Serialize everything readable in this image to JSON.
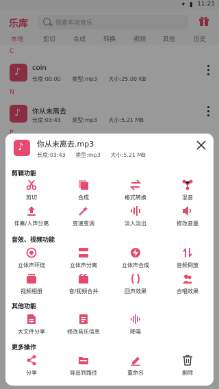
{
  "status": {
    "time": "11:21"
  },
  "app": {
    "title": "乐库",
    "search_placeholder": "搜索本地音乐"
  },
  "tabs": [
    "本地",
    "剪切",
    "合成",
    "转换",
    "视频",
    "其他",
    "历史"
  ],
  "songs": {
    "group_c": "C",
    "group_n": "N",
    "group_p": "P",
    "items": [
      {
        "name": "coin",
        "length": "长度:00:00",
        "type": "类型:mp3",
        "size": "大小:25.00 KB"
      },
      {
        "name": "你从未离去",
        "length": "长度:03:43",
        "type": "类型:mp3",
        "size": "大小:5.21 MB"
      }
    ]
  },
  "sheet": {
    "title": "你从未离去.mp3",
    "length": "长度:03:43",
    "type": "类型:mp3",
    "size": "大小:5.21 MB",
    "sections": [
      {
        "title": "剪辑功能",
        "items": [
          {
            "label": "剪切",
            "icon": "scissors-icon"
          },
          {
            "label": "合成",
            "icon": "stack-icon"
          },
          {
            "label": "格式转换",
            "icon": "swap-icon"
          },
          {
            "label": "混音",
            "icon": "mix-icon"
          },
          {
            "label": "伴奏/人声分离",
            "icon": "upload-icon"
          },
          {
            "label": "变速变调",
            "icon": "magic-wand-icon"
          },
          {
            "label": "淡入淡出",
            "icon": "fade-bars-icon"
          },
          {
            "label": "修改音量",
            "icon": "volume-icon"
          }
        ]
      },
      {
        "title": "音效、视频功能",
        "items": [
          {
            "label": "立体声环绕",
            "icon": "surround-icon"
          },
          {
            "label": "立体声分离",
            "icon": "split-icon"
          },
          {
            "label": "立体声合成",
            "icon": "bolt-icon"
          },
          {
            "label": "音频倒放",
            "icon": "reverse-icon"
          },
          {
            "label": "视频相册",
            "icon": "album-icon"
          },
          {
            "label": "音/视频合并",
            "icon": "video-merge-icon"
          },
          {
            "label": "回声效果",
            "icon": "echo-icon"
          },
          {
            "label": "合唱效果",
            "icon": "chorus-icon"
          }
        ]
      },
      {
        "title": "其他功能",
        "items": [
          {
            "label": "大文件分享",
            "icon": "file-share-icon"
          },
          {
            "label": "修改音乐信息",
            "icon": "doc-edit-icon"
          },
          {
            "label": "降噪",
            "icon": "waveform-icon"
          }
        ]
      },
      {
        "title": "更多操作",
        "items": [
          {
            "label": "分享",
            "icon": "share-icon"
          },
          {
            "label": "导出到路径",
            "icon": "export-folder-icon"
          },
          {
            "label": "重命名",
            "icon": "pencil-icon"
          },
          {
            "label": "删除",
            "icon": "trash-icon"
          }
        ]
      }
    ]
  },
  "colors": {
    "accent": "#e64a6e",
    "overlay": "rgba(0,0,0,0.40)"
  }
}
